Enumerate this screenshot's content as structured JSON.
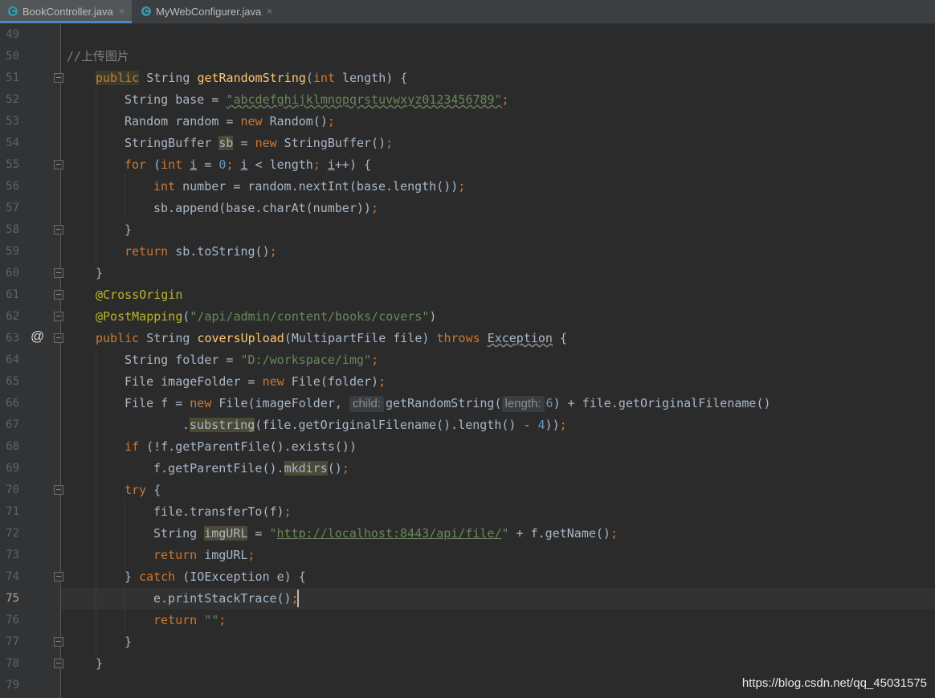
{
  "tabs": [
    {
      "label": "BookController.java",
      "icon": "c-class-icon",
      "close": "×",
      "active": true
    },
    {
      "label": "MyWebConfigurer.java",
      "icon": "c-class-icon",
      "close": "×",
      "active": false
    }
  ],
  "editor": {
    "current_line": 75,
    "gutter_at_line": 63,
    "at_symbol": "@",
    "lines": [
      {
        "n": "49"
      },
      {
        "n": "50",
        "comment": "//上传图片"
      },
      {
        "n": "51",
        "t": {
          "kw1": "public",
          "rest1": " String ",
          "fn": "getRandomString",
          "p1": "(",
          "kw2": "int",
          "rest2": " length) {"
        }
      },
      {
        "n": "52",
        "t": {
          "a": "String base = ",
          "s": "\"abcdefghijklmnopqrstuvwxyz0123456789\"",
          "semi": ";"
        }
      },
      {
        "n": "53",
        "t": {
          "a": "Random random = ",
          "kw": "new",
          "b": " Random()",
          "semi": ";"
        }
      },
      {
        "n": "54",
        "t": {
          "a": "StringBuffer ",
          "v": "sb",
          "b": " = ",
          "kw": "new",
          "c": " StringBuffer()",
          "semi": ";"
        }
      },
      {
        "n": "55",
        "t": {
          "kw1": "for",
          "a": " (",
          "kw2": "int",
          "b": " ",
          "i1": "i",
          "c": " = ",
          "num": "0",
          "semi1": ";",
          "d": " ",
          "i2": "i",
          "e": " < length",
          "semi2": ";",
          "f": " ",
          "i3": "i",
          "g": "++) {"
        }
      },
      {
        "n": "56",
        "t": {
          "kw": "int",
          "a": " number = random.nextInt(base.length())",
          "semi": ";"
        }
      },
      {
        "n": "57",
        "t": {
          "a": "sb.append(base.charAt(number))",
          "semi": ";"
        }
      },
      {
        "n": "58",
        "t": {
          "a": "}"
        }
      },
      {
        "n": "59",
        "t": {
          "kw": "return",
          "a": " sb.toString()",
          "semi": ";"
        }
      },
      {
        "n": "60",
        "t": {
          "a": "}"
        }
      },
      {
        "n": "61",
        "t": {
          "ann": "@CrossOrigin"
        }
      },
      {
        "n": "62",
        "t": {
          "ann": "@PostMapping",
          "a": "(",
          "s": "\"/api/admin/content/books/covers\"",
          "b": ")"
        }
      },
      {
        "n": "63",
        "t": {
          "kw1": "public",
          "a": " String ",
          "fn": "coversUpload",
          "b": "(MultipartFile file) ",
          "kw2": "throws",
          "c": " ",
          "exc": "Exception",
          "d": " {"
        }
      },
      {
        "n": "64",
        "t": {
          "a": "String folder = ",
          "s": "\"D:/workspace/img\"",
          "semi": ";"
        }
      },
      {
        "n": "65",
        "t": {
          "a": "File imageFolder = ",
          "kw": "new",
          "b": " File(folder)",
          "semi": ";"
        }
      },
      {
        "n": "66",
        "t": {
          "a": "File f = ",
          "kw": "new",
          "b": " File(imageFolder, ",
          "hint1": "child:",
          "c": "getRandomString(",
          "hint2": "length:",
          "num": "6",
          "d": ") + file.getOriginalFilename()"
        }
      },
      {
        "n": "67",
        "t": {
          "a": ".",
          "fnhl": "substring",
          "b": "(file.getOriginalFilename().length() - ",
          "num": "4",
          "c": "))",
          "semi": ";"
        }
      },
      {
        "n": "68",
        "t": {
          "kw": "if",
          "a": " (!f.getParentFile().exists())"
        }
      },
      {
        "n": "69",
        "t": {
          "a": "f.getParentFile().",
          "v": "mkdirs",
          "b": "()",
          "semi": ";"
        }
      },
      {
        "n": "70",
        "t": {
          "kw": "try",
          "a": " {"
        }
      },
      {
        "n": "71",
        "t": {
          "a": "file.transferTo(f)",
          "semi": ";"
        }
      },
      {
        "n": "72",
        "t": {
          "a": "String ",
          "v": "imgURL",
          "b": " = ",
          "s1": "\"",
          "s2": "http://localhost:8443/api/file/",
          "s3": "\"",
          "c": " + f.getName()",
          "semi": ";"
        }
      },
      {
        "n": "73",
        "t": {
          "kw": "return",
          "a": " imgURL",
          "semi": ";"
        }
      },
      {
        "n": "74",
        "t": {
          "a": "} ",
          "kw": "catch",
          "b": " (IOException e) {"
        }
      },
      {
        "n": "75",
        "t": {
          "a": "e.printStackTrace()",
          "semi": ";"
        }
      },
      {
        "n": "76",
        "t": {
          "kw": "return",
          "a": " ",
          "s": "\"\"",
          "semi": ";"
        }
      },
      {
        "n": "77",
        "t": {
          "a": "}"
        }
      },
      {
        "n": "78",
        "t": {
          "a": "}"
        }
      },
      {
        "n": "79"
      }
    ]
  },
  "watermark": "https://blog.csdn.net/qq_45031575",
  "colors": {
    "background": "#2b2b2b",
    "keyword": "#cc7832",
    "string": "#6a8759",
    "function": "#ffc66d",
    "annotation": "#bbb529",
    "number": "#6897bb",
    "text": "#a9b7c6"
  }
}
